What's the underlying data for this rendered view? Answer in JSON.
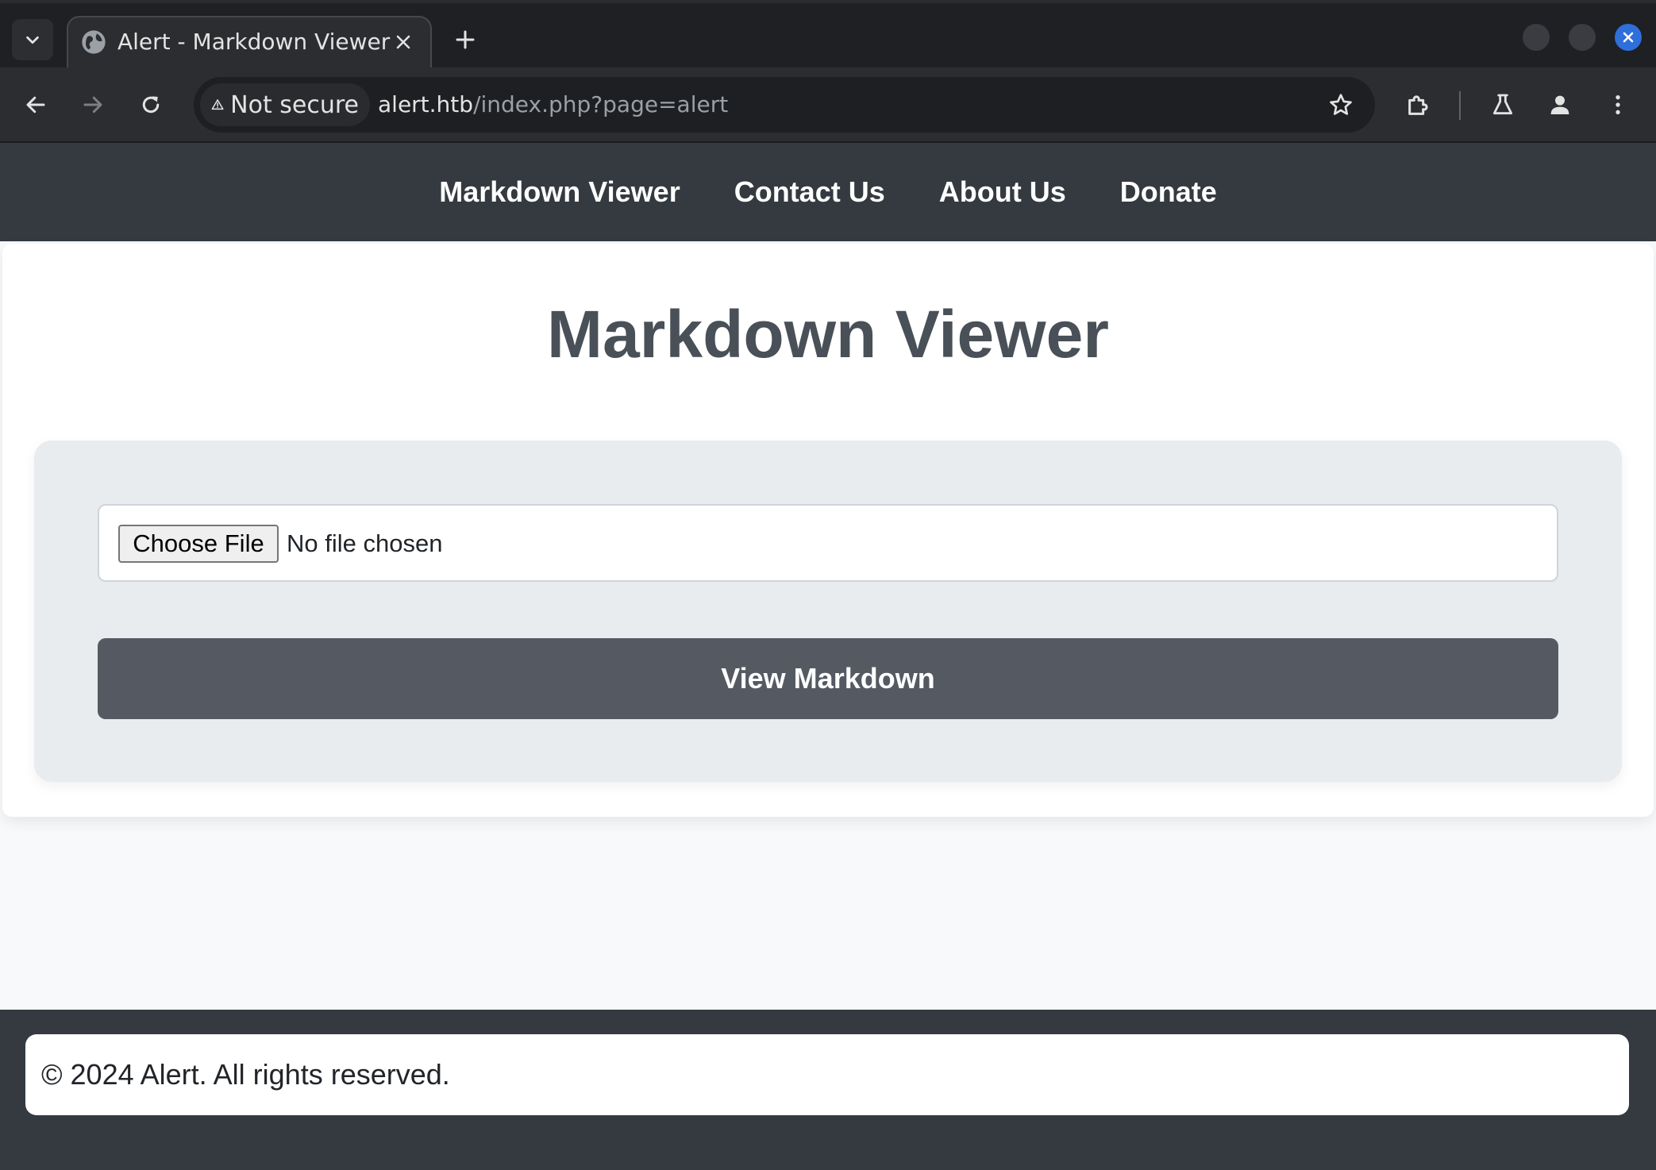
{
  "browser": {
    "tab": {
      "title": "Alert - Markdown Viewer",
      "favicon": "globe-icon"
    },
    "address_bar": {
      "security_label": "Not secure",
      "url_host": "alert.htb",
      "url_path": "/index.php?page=alert"
    },
    "colors": {
      "chrome_dark": "#1f2023",
      "toolbar": "#2c2d30",
      "close_accent": "#2f6fdb"
    }
  },
  "page": {
    "nav": {
      "items": [
        {
          "label": "Markdown Viewer"
        },
        {
          "label": "Contact Us"
        },
        {
          "label": "About Us"
        },
        {
          "label": "Donate"
        }
      ]
    },
    "title": "Markdown Viewer",
    "form": {
      "file_button_label": "Choose File",
      "file_status": "No file chosen",
      "submit_label": "View Markdown"
    },
    "footer": {
      "text": "© 2024 Alert. All rights reserved."
    },
    "colors": {
      "navbar": "#343a40",
      "heading": "#495057",
      "button": "#555a62",
      "card": "#e9ecef"
    }
  }
}
